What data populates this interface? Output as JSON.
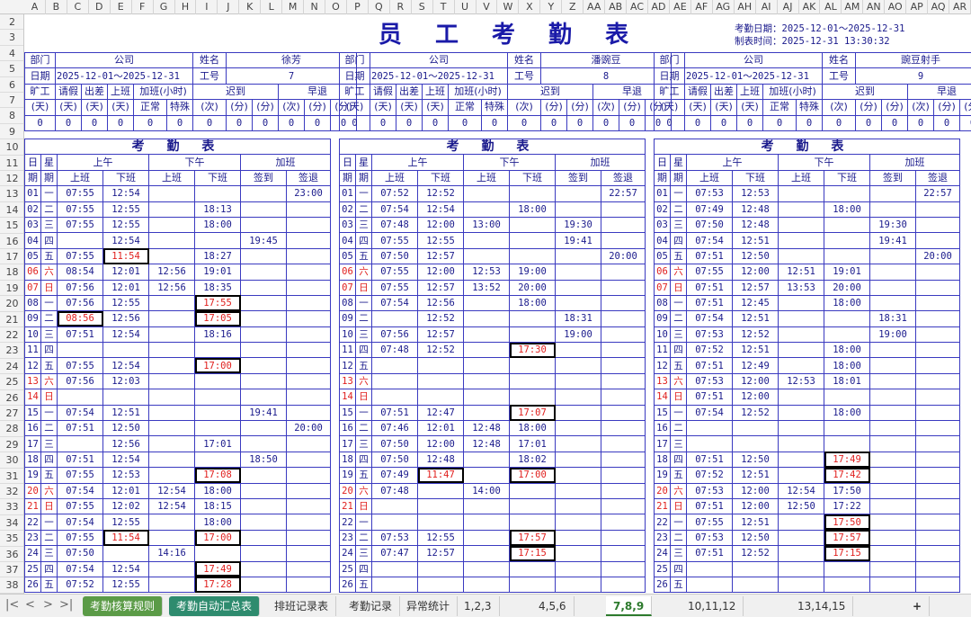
{
  "columns": [
    "A",
    "B",
    "C",
    "D",
    "E",
    "F",
    "G",
    "H",
    "I",
    "J",
    "K",
    "L",
    "M",
    "N",
    "O",
    "P",
    "Q",
    "R",
    "S",
    "T",
    "U",
    "V",
    "W",
    "X",
    "Y",
    "Z",
    "AA",
    "AB",
    "AC",
    "AD",
    "AE",
    "AF",
    "AG",
    "AH",
    "AI",
    "AJ",
    "AK",
    "AL",
    "AM",
    "AN",
    "AO",
    "AP",
    "AQ",
    "AR"
  ],
  "title": "员 工 考 勤 表",
  "meta": {
    "date_label": "考勤日期：2025-12-01～2025-12-31",
    "made_label": "制表时间：2025-12-31 13:30:32"
  },
  "labels": {
    "dept": "部门",
    "company": "公司",
    "name": "姓名",
    "period": "日期",
    "id": "工号",
    "absent": "旷工",
    "leave": "请假",
    "trip": "出差",
    "work": "上班",
    "ot": "加班(小时)",
    "late": "迟到",
    "early": "早退",
    "day": "(天)",
    "normal": "正常",
    "special": "特殊",
    "times": "(次)",
    "minutes": "(分)",
    "sheet_title": "考 勤 表",
    "date1": "日",
    "week1": "星",
    "date2": "期",
    "week2": "期",
    "am": "上午",
    "pm": "下午",
    "overtime": "加班",
    "in": "上班",
    "out": "下班",
    "sign_in": "签到",
    "sign_out": "签退"
  },
  "employees": [
    {
      "name": "徐芳",
      "id": "7",
      "period": "2025-12-01～2025-12-31",
      "summary": [
        "0",
        "0",
        "0",
        "0",
        "0",
        "0",
        "0",
        "0",
        "0",
        "0"
      ],
      "rows": [
        [
          "01",
          "一",
          "07:55",
          "12:54",
          "",
          "",
          "",
          "23:00"
        ],
        [
          "02",
          "二",
          "07:55",
          "12:55",
          "",
          "18:13",
          "",
          ""
        ],
        [
          "03",
          "三",
          "07:55",
          "12:55",
          "",
          "18:00",
          "",
          ""
        ],
        [
          "04",
          "四",
          "",
          "12:54",
          "",
          "",
          "19:45",
          ""
        ],
        [
          "05",
          "五",
          "07:55",
          "11:54",
          "",
          "18:27",
          "",
          ""
        ],
        [
          "06",
          "六",
          "08:54",
          "12:01",
          "12:56",
          "19:01",
          "",
          ""
        ],
        [
          "07",
          "日",
          "07:56",
          "12:01",
          "12:56",
          "18:35",
          "",
          ""
        ],
        [
          "08",
          "一",
          "07:56",
          "12:55",
          "",
          "17:55",
          "",
          ""
        ],
        [
          "09",
          "二",
          "08:56",
          "12:56",
          "",
          "17:05",
          "",
          ""
        ],
        [
          "10",
          "三",
          "07:51",
          "12:54",
          "",
          "18:16",
          "",
          ""
        ],
        [
          "11",
          "四",
          "",
          "",
          "",
          "",
          "",
          ""
        ],
        [
          "12",
          "五",
          "07:55",
          "12:54",
          "",
          "17:00",
          "",
          ""
        ],
        [
          "13",
          "六",
          "07:56",
          "12:03",
          "",
          "",
          "",
          ""
        ],
        [
          "14",
          "日",
          "",
          "",
          "",
          "",
          "",
          ""
        ],
        [
          "15",
          "一",
          "07:54",
          "12:51",
          "",
          "",
          "19:41",
          ""
        ],
        [
          "16",
          "二",
          "07:51",
          "12:50",
          "",
          "",
          "",
          "20:00"
        ],
        [
          "17",
          "三",
          "",
          "12:56",
          "",
          "17:01",
          "",
          ""
        ],
        [
          "18",
          "四",
          "07:51",
          "12:54",
          "",
          "",
          "18:50",
          ""
        ],
        [
          "19",
          "五",
          "07:55",
          "12:53",
          "",
          "17:08",
          "",
          ""
        ],
        [
          "20",
          "六",
          "07:54",
          "12:01",
          "12:54",
          "18:00",
          "",
          ""
        ],
        [
          "21",
          "日",
          "07:55",
          "12:02",
          "12:54",
          "18:15",
          "",
          ""
        ],
        [
          "22",
          "一",
          "07:54",
          "12:55",
          "",
          "18:00",
          "",
          ""
        ],
        [
          "23",
          "二",
          "07:55",
          "11:54",
          "",
          "17:00",
          "",
          ""
        ],
        [
          "24",
          "三",
          "07:50",
          "",
          "14:16",
          "",
          "",
          ""
        ],
        [
          "25",
          "四",
          "07:54",
          "12:54",
          "",
          "17:49",
          "",
          ""
        ],
        [
          "26",
          "五",
          "07:52",
          "12:55",
          "",
          "17:28",
          "",
          ""
        ]
      ]
    },
    {
      "name": "潘豌豆",
      "id": "8",
      "period": "2025-12-01～2025-12-31",
      "summary": [
        "0",
        "0",
        "0",
        "0",
        "0",
        "0",
        "0",
        "0",
        "0",
        "0"
      ],
      "rows": [
        [
          "01",
          "一",
          "07:52",
          "12:52",
          "",
          "",
          "",
          "22:57"
        ],
        [
          "02",
          "二",
          "07:54",
          "12:54",
          "",
          "18:00",
          "",
          ""
        ],
        [
          "03",
          "三",
          "07:48",
          "12:00",
          "13:00",
          "",
          "19:30",
          ""
        ],
        [
          "04",
          "四",
          "07:55",
          "12:55",
          "",
          "",
          "19:41",
          ""
        ],
        [
          "05",
          "五",
          "07:50",
          "12:57",
          "",
          "",
          "",
          "20:00"
        ],
        [
          "06",
          "六",
          "07:55",
          "12:00",
          "12:53",
          "19:00",
          "",
          ""
        ],
        [
          "07",
          "日",
          "07:55",
          "12:57",
          "13:52",
          "20:00",
          "",
          ""
        ],
        [
          "08",
          "一",
          "07:54",
          "12:56",
          "",
          "18:00",
          "",
          ""
        ],
        [
          "09",
          "二",
          "",
          "12:52",
          "",
          "",
          "18:31",
          ""
        ],
        [
          "10",
          "三",
          "07:56",
          "12:57",
          "",
          "",
          "19:00",
          ""
        ],
        [
          "11",
          "四",
          "07:48",
          "12:52",
          "",
          "17:30",
          "",
          ""
        ],
        [
          "12",
          "五",
          "",
          "",
          "",
          "",
          "",
          ""
        ],
        [
          "13",
          "六",
          "",
          "",
          "",
          "",
          "",
          ""
        ],
        [
          "14",
          "日",
          "",
          "",
          "",
          "",
          "",
          ""
        ],
        [
          "15",
          "一",
          "07:51",
          "12:47",
          "",
          "17:07",
          "",
          ""
        ],
        [
          "16",
          "二",
          "07:46",
          "12:01",
          "12:48",
          "18:00",
          "",
          ""
        ],
        [
          "17",
          "三",
          "07:50",
          "12:00",
          "12:48",
          "17:01",
          "",
          ""
        ],
        [
          "18",
          "四",
          "07:50",
          "12:48",
          "",
          "18:02",
          "",
          ""
        ],
        [
          "19",
          "五",
          "07:49",
          "11:47",
          "",
          "17:00",
          "",
          ""
        ],
        [
          "20",
          "六",
          "07:48",
          "",
          "14:00",
          "",
          "",
          ""
        ],
        [
          "21",
          "日",
          "",
          "",
          "",
          "",
          "",
          ""
        ],
        [
          "22",
          "一",
          "",
          "",
          "",
          "",
          "",
          ""
        ],
        [
          "23",
          "二",
          "07:53",
          "12:55",
          "",
          "17:57",
          "",
          ""
        ],
        [
          "24",
          "三",
          "07:47",
          "12:57",
          "",
          "17:15",
          "",
          ""
        ],
        [
          "25",
          "四",
          "",
          "",
          "",
          "",
          "",
          ""
        ],
        [
          "26",
          "五",
          "",
          "",
          "",
          "",
          "",
          ""
        ]
      ]
    },
    {
      "name": "豌豆射手",
      "id": "9",
      "period": "2025-12-01～2025-12-31",
      "summary": [
        "0",
        "0",
        "0",
        "0",
        "0",
        "0",
        "0",
        "0",
        "0",
        "0"
      ],
      "rows": [
        [
          "01",
          "一",
          "07:53",
          "12:53",
          "",
          "",
          "",
          "22:57"
        ],
        [
          "02",
          "二",
          "07:49",
          "12:48",
          "",
          "18:00",
          "",
          ""
        ],
        [
          "03",
          "三",
          "07:50",
          "12:48",
          "",
          "",
          "19:30",
          ""
        ],
        [
          "04",
          "四",
          "07:54",
          "12:51",
          "",
          "",
          "19:41",
          ""
        ],
        [
          "05",
          "五",
          "07:51",
          "12:50",
          "",
          "",
          "",
          "20:00"
        ],
        [
          "06",
          "六",
          "07:55",
          "12:00",
          "12:51",
          "19:01",
          "",
          ""
        ],
        [
          "07",
          "日",
          "07:51",
          "12:57",
          "13:53",
          "20:00",
          "",
          ""
        ],
        [
          "08",
          "一",
          "07:51",
          "12:45",
          "",
          "18:00",
          "",
          ""
        ],
        [
          "09",
          "二",
          "07:54",
          "12:51",
          "",
          "",
          "18:31",
          ""
        ],
        [
          "10",
          "三",
          "07:53",
          "12:52",
          "",
          "",
          "19:00",
          ""
        ],
        [
          "11",
          "四",
          "07:52",
          "12:51",
          "",
          "18:00",
          "",
          ""
        ],
        [
          "12",
          "五",
          "07:51",
          "12:49",
          "",
          "18:00",
          "",
          ""
        ],
        [
          "13",
          "六",
          "07:53",
          "12:00",
          "12:53",
          "18:01",
          "",
          ""
        ],
        [
          "14",
          "日",
          "07:51",
          "12:00",
          "",
          "",
          "",
          ""
        ],
        [
          "15",
          "一",
          "07:54",
          "12:52",
          "",
          "18:00",
          "",
          ""
        ],
        [
          "16",
          "二",
          "",
          "",
          "",
          "",
          "",
          ""
        ],
        [
          "17",
          "三",
          "",
          "",
          "",
          "",
          "",
          ""
        ],
        [
          "18",
          "四",
          "07:51",
          "12:50",
          "",
          "17:49",
          "",
          ""
        ],
        [
          "19",
          "五",
          "07:52",
          "12:51",
          "",
          "17:42",
          "",
          ""
        ],
        [
          "20",
          "六",
          "07:53",
          "12:00",
          "12:54",
          "17:50",
          "",
          ""
        ],
        [
          "21",
          "日",
          "07:51",
          "12:00",
          "12:50",
          "17:22",
          "",
          ""
        ],
        [
          "22",
          "一",
          "07:55",
          "12:51",
          "",
          "17:50",
          "",
          ""
        ],
        [
          "23",
          "二",
          "07:53",
          "12:50",
          "",
          "17:57",
          "",
          ""
        ],
        [
          "24",
          "三",
          "07:51",
          "12:52",
          "",
          "17:15",
          "",
          ""
        ],
        [
          "25",
          "四",
          "",
          "",
          "",
          "",
          "",
          ""
        ],
        [
          "26",
          "五",
          "",
          "",
          "",
          "",
          "",
          ""
        ]
      ]
    }
  ],
  "highlights": {
    "0": [
      "4-3",
      "7-5",
      "8-2",
      "8-5",
      "11-5",
      "18-5",
      "22-3",
      "22-5",
      "24-5",
      "25-5"
    ],
    "1": [
      "10-5",
      "14-5",
      "18-3",
      "18-5",
      "22-5",
      "23-5"
    ],
    "2": [
      "17-5",
      "18-5",
      "21-5",
      "22-5",
      "23-5"
    ]
  },
  "tabs": [
    "考勤核算规则",
    "考勤自动汇总表",
    "排班记录表",
    "考勤记录",
    "异常统计",
    "1,2,3",
    "4,5,6",
    "7,8,9",
    "10,11,12",
    "13,14,15"
  ],
  "add_tab": "+"
}
